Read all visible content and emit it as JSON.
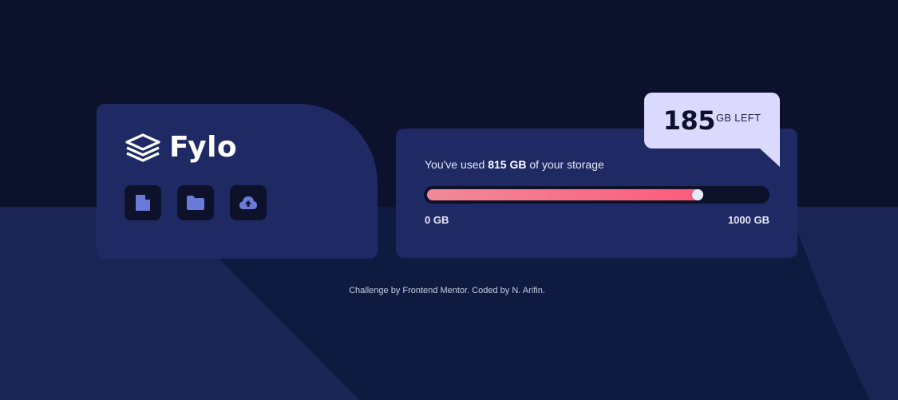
{
  "brand": {
    "name": "Fylo",
    "logo_icon": "fylo-layers-icon"
  },
  "actions": [
    {
      "icon": "document-icon"
    },
    {
      "icon": "folder-icon"
    },
    {
      "icon": "upload-icon"
    }
  ],
  "storage": {
    "prefix": "You've used ",
    "used_label": "815 GB",
    "suffix": " of your storage",
    "min_label": "0 GB",
    "max_label": "1000 GB",
    "used": 815,
    "max": 1000,
    "left_value": "185",
    "left_unit": "GB LEFT"
  },
  "footer": {
    "attribution": "Challenge by Frontend Mentor. Coded by N. Arifin."
  },
  "colors": {
    "page": "#0d1129",
    "card": "#1f2a64",
    "callout": "#dcd9ff",
    "meter_start": "#f18a9a",
    "meter_end": "#fc5a7b",
    "icon": "#6a7ad9"
  }
}
